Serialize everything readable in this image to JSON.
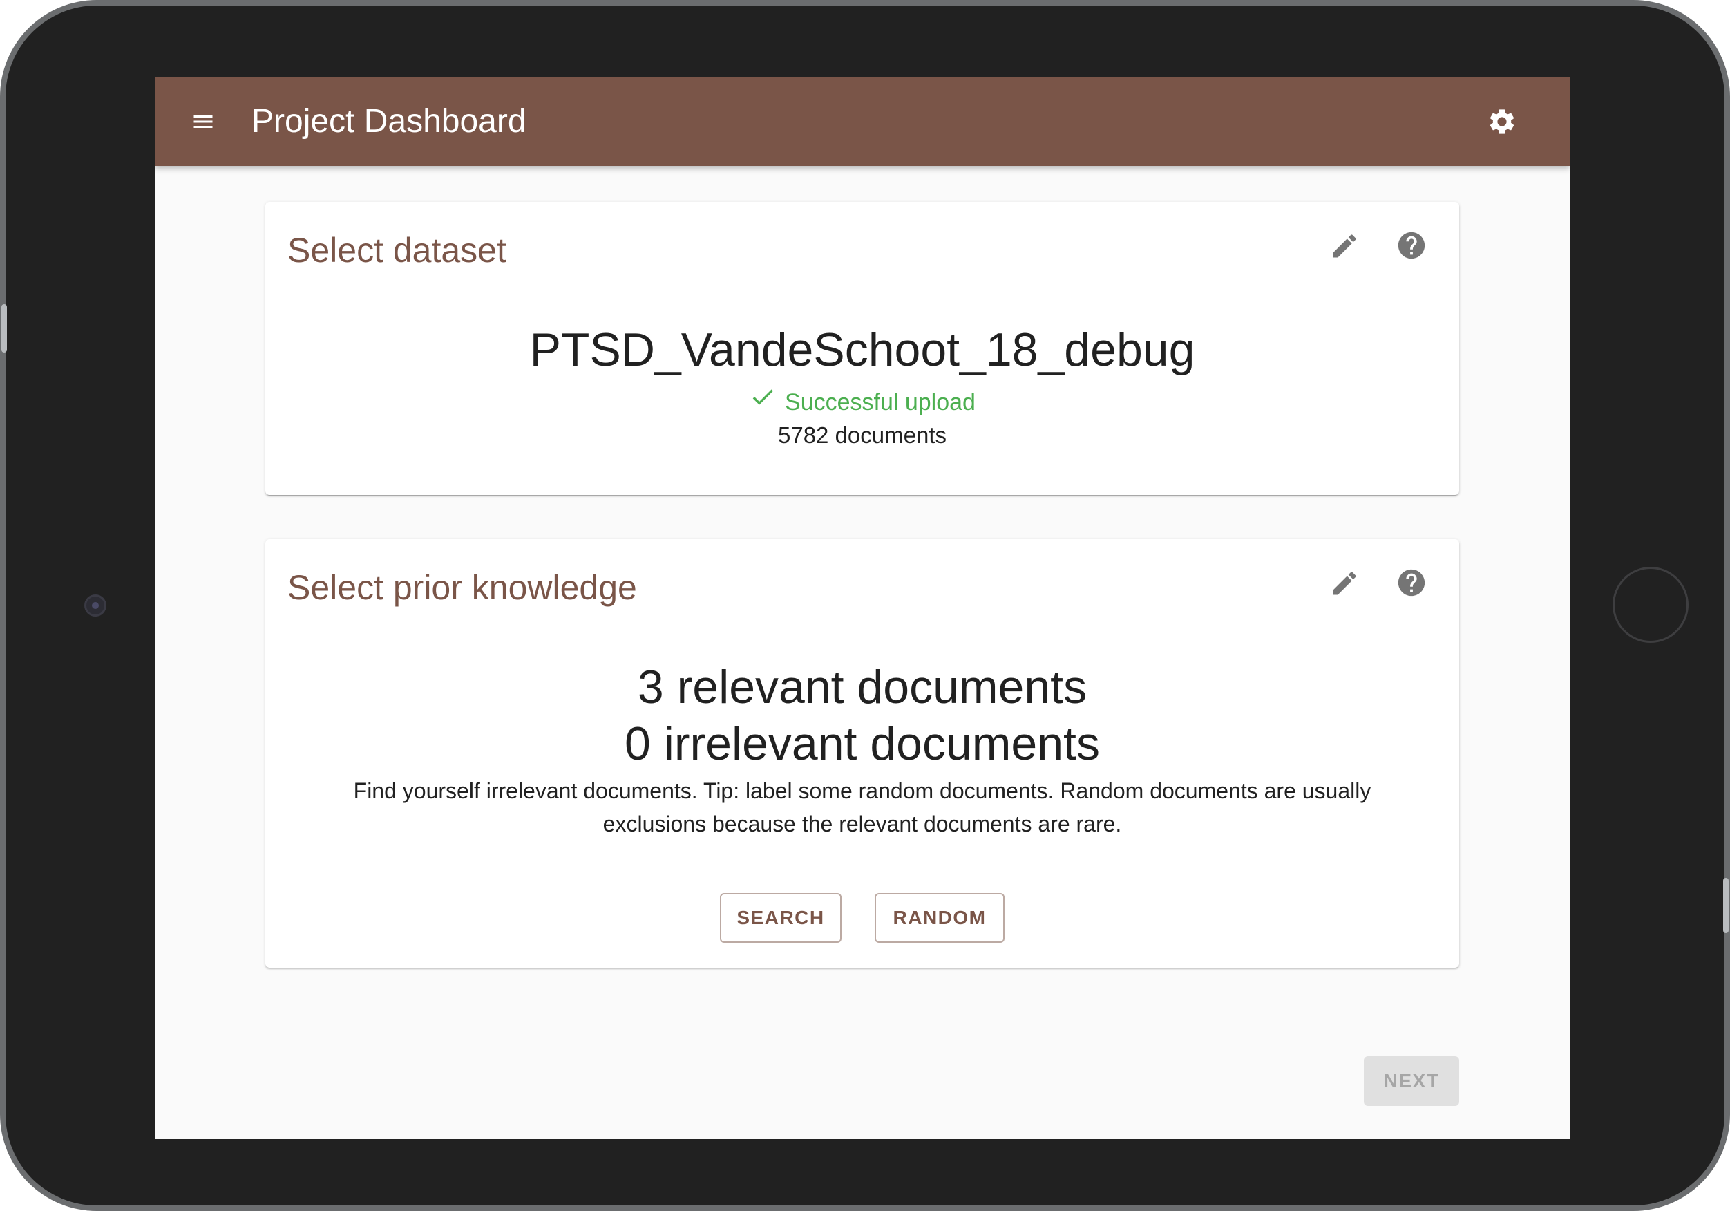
{
  "appbar": {
    "title": "Project Dashboard",
    "menu_icon": "menu-icon",
    "settings_icon": "gear-icon",
    "color": "#7a5548"
  },
  "dataset_card": {
    "title": "Select dataset",
    "edit_icon": "pencil-icon",
    "help_icon": "help-icon",
    "dataset_name": "PTSD_VandeSchoot_18_debug",
    "status_text": "Successful upload",
    "status_color": "#4caf50",
    "document_count": "5782 documents"
  },
  "prior_card": {
    "title": "Select prior knowledge",
    "edit_icon": "pencil-icon",
    "help_icon": "help-icon",
    "relevant": "3 relevant documents",
    "irrelevant": "0 irrelevant documents",
    "tip_line1": "Find yourself irrelevant documents. Tip: label some random documents. Random documents are usually",
    "tip_line2": "exclusions because the relevant documents are rare.",
    "search_label": "SEARCH",
    "random_label": "RANDOM"
  },
  "footer": {
    "next_label": "NEXT",
    "next_disabled": true
  }
}
